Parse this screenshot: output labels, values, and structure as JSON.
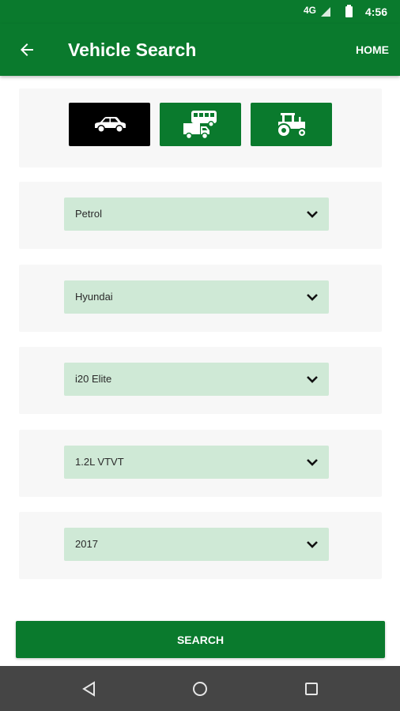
{
  "status_bar": {
    "network": "4G",
    "time": "4:56"
  },
  "app_bar": {
    "title": "Vehicle Search",
    "home_label": "HOME"
  },
  "vehicle_types": [
    {
      "name": "car",
      "icon": "car-icon",
      "selected": true
    },
    {
      "name": "truck-bus",
      "icon": "truck-bus-icon",
      "selected": false
    },
    {
      "name": "tractor",
      "icon": "tractor-icon",
      "selected": false
    }
  ],
  "selects": [
    {
      "value": "Petrol"
    },
    {
      "value": "Hyundai"
    },
    {
      "value": "i20 Elite"
    },
    {
      "value": "1.2L VTVT"
    },
    {
      "value": "2017"
    }
  ],
  "search_label": "SEARCH",
  "colors": {
    "primary": "#0a7a2d",
    "select_bg": "#cfe9d6",
    "card_bg": "#f7f7f7",
    "nav_bg": "#454545"
  }
}
